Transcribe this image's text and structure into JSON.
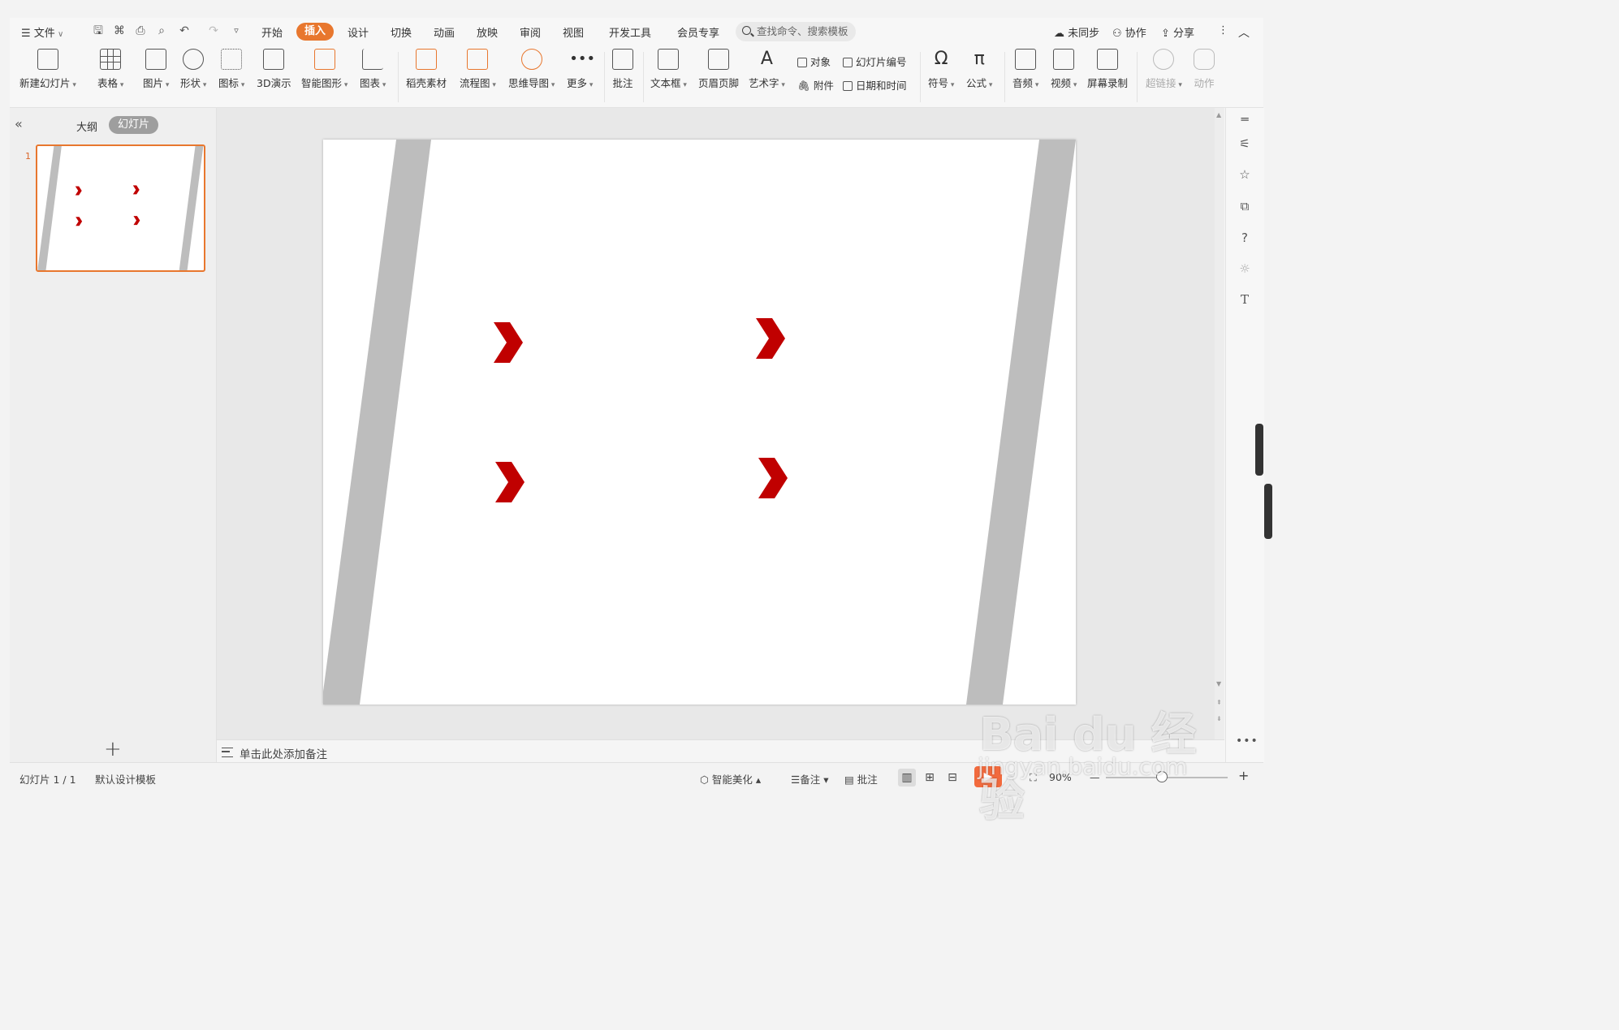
{
  "menu": {
    "file": "文件",
    "tabs": [
      "开始",
      "插入",
      "设计",
      "切换",
      "动画",
      "放映",
      "审阅",
      "视图",
      "开发工具",
      "会员专享"
    ],
    "active_tab": "插入",
    "search_placeholder": "查找命令、搜索模板",
    "right": {
      "sync": "未同步",
      "collab": "协作",
      "share": "分享"
    }
  },
  "ribbon": {
    "items": [
      "新建幻灯片",
      "表格",
      "图片",
      "形状",
      "图标",
      "3D演示",
      "智能图形",
      "图表",
      "稻壳素材",
      "流程图",
      "思维导图",
      "更多",
      "批注",
      "文本框",
      "页眉页脚",
      "艺术字"
    ],
    "small": {
      "object": "对象",
      "slide_number": "幻灯片编号",
      "attachment": "附件",
      "datetime": "日期和时间"
    },
    "items2": [
      "符号",
      "公式",
      "音频",
      "视频",
      "屏幕录制",
      "超链接",
      "动作"
    ]
  },
  "left_panel": {
    "tab_outline": "大纲",
    "tab_slides": "幻灯片",
    "slide_number": "1"
  },
  "notes_placeholder": "单击此处添加备注",
  "status": {
    "slide_count": "幻灯片 1 / 1",
    "template": "默认设计模板",
    "beautify": "智能美化",
    "notes": "备注",
    "comments": "批注",
    "zoom": "90%"
  },
  "watermark": {
    "logo": "Bai du 经验",
    "url": "jingyan.baidu.com"
  },
  "colors": {
    "accent": "#e8772e",
    "arrow_red": "#c00000",
    "bar_gray": "#bdbdbd"
  }
}
